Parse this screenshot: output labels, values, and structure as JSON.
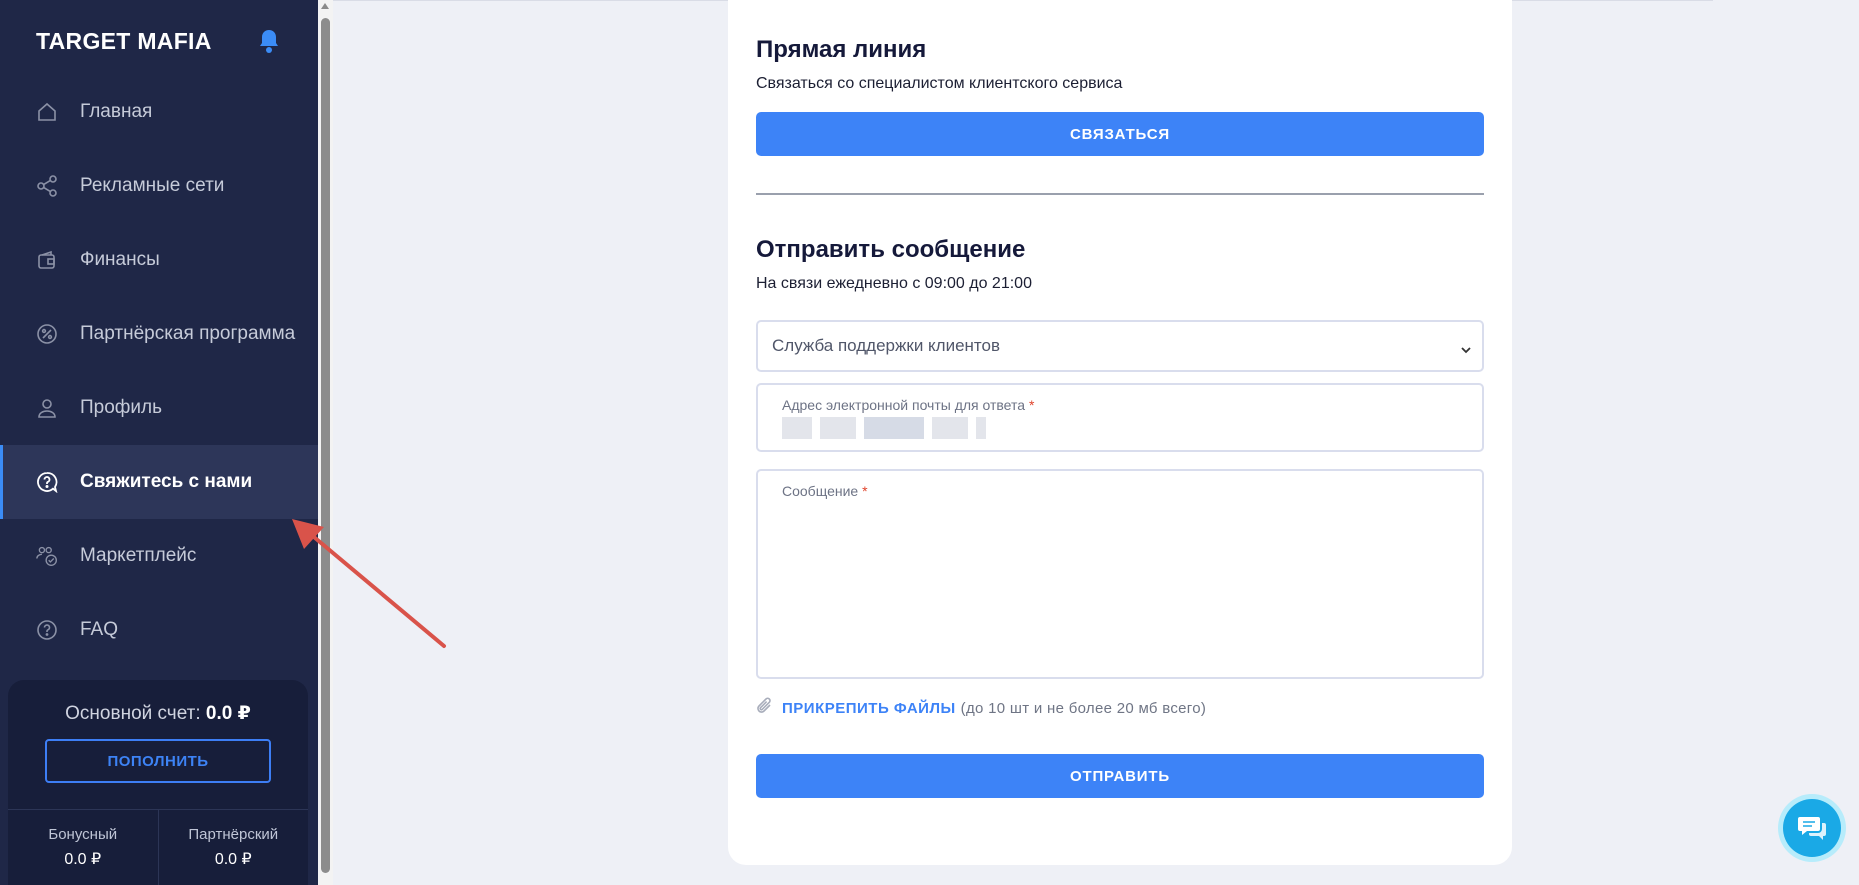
{
  "sidebar": {
    "brand": "TARGET MAFIA",
    "items": [
      {
        "label": "Главная",
        "icon": "home-icon"
      },
      {
        "label": "Рекламные сети",
        "icon": "share-icon"
      },
      {
        "label": "Финансы",
        "icon": "wallet-icon"
      },
      {
        "label": "Партнёрская программа",
        "icon": "percent-icon"
      },
      {
        "label": "Профиль",
        "icon": "user-icon"
      },
      {
        "label": "Свяжитесь с нами",
        "icon": "question-chat-icon",
        "active": true
      },
      {
        "label": "Маркетплейс",
        "icon": "users-check-icon"
      },
      {
        "label": "FAQ",
        "icon": "question-icon"
      }
    ],
    "balance": {
      "label": "Основной счет:",
      "value": "0.0 ₽",
      "topup_label": "ПОПОЛНИТЬ",
      "bonus_label": "Бонусный",
      "bonus_value": "0.0 ₽",
      "partner_label": "Партнёрский",
      "partner_value": "0.0 ₽"
    }
  },
  "direct_line": {
    "title": "Прямая линия",
    "subtitle": "Связаться со специалистом клиентского сервиса",
    "button": "СВЯЗАТЬСЯ"
  },
  "message_form": {
    "title": "Отправить сообщение",
    "subtitle": "На связи ежедневно с 09:00 до 21:00",
    "department_selected": "Служба поддержки клиентов",
    "email_label": "Адрес электронной почты для ответа",
    "message_label": "Сообщение",
    "required_mark": "*",
    "attach_label": "ПРИКРЕПИТЬ ФАЙЛЫ",
    "attach_note": "(до 10 шт и не более 20 мб всего)",
    "submit": "ОТПРАВИТЬ"
  },
  "colors": {
    "sidebar_bg": "#1f2747",
    "accent": "#3d83f7",
    "chat_bubble": "#1aa9e6",
    "annotation_arrow": "#d9534a"
  }
}
